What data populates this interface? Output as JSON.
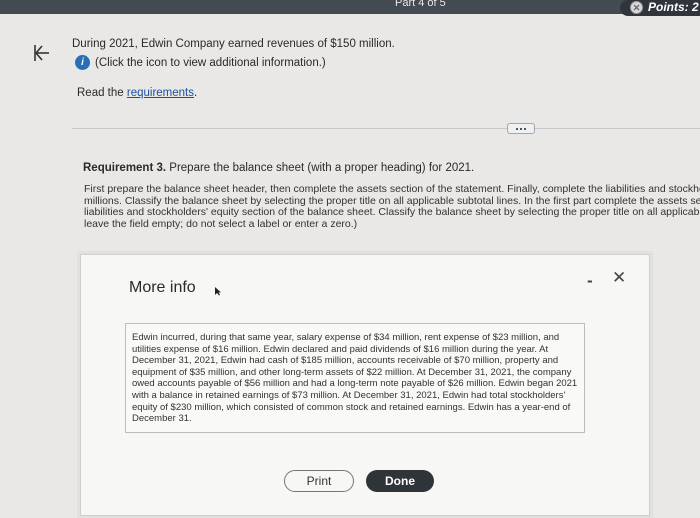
{
  "header": {
    "part_label": "Part 4 of 5",
    "points_label": "Points: 2"
  },
  "question": {
    "statement": "During 2021, Edwin Company earned revenues of $150 million.",
    "info_text": "(Click the icon to view additional information.)",
    "read_prefix": "Read the ",
    "requirements_link": "requirements",
    "read_suffix": "."
  },
  "requirement": {
    "label": "Requirement 3.",
    "text": " Prepare the balance sheet (with a proper heading) for 2021.",
    "instructions": [
      "First prepare the balance sheet header, then complete the assets section of the statement. Finally, complete the liabilities and stockholder",
      "millions. Classify the balance sheet by selecting the proper title on all applicable subtotal lines. In the first part complete the assets section",
      "liabilities and stockholders' equity section of the balance sheet. Classify the balance sheet by selecting the proper title on all applicable sub",
      "leave the field empty; do not select a label or enter a zero.)"
    ]
  },
  "modal": {
    "title": "More info",
    "minimize_glyph": "-",
    "close_glyph": "✕",
    "body_lines": [
      "Edwin incurred, during that same year, salary expense of $34 million, rent expense of $23 million, and",
      "utilities expense of $16 million. Edwin declared and paid dividends of $16 million during the year. At",
      "December 31, 2021, Edwin had cash of $185 million, accounts receivable of $70 million, property and",
      "equipment of $35 million, and other long-term assets of $22 million. At December 31, 2021, the company",
      "owed accounts payable of $56 million and had a long-term note payable of $26 million. Edwin began 2021",
      "with a balance in retained earnings of $73 million. At December 31, 2021, Edwin had total stockholders'",
      "equity of $230 million, which consisted of common stock and retained earnings. Edwin has a year-end of",
      "December 31."
    ],
    "print_label": "Print",
    "done_label": "Done"
  },
  "icons": {
    "back": "back-arrow-icon",
    "info": "info-icon",
    "points": "points-icon",
    "expand": "more-dots-icon",
    "cursor": "mouse-cursor-icon"
  },
  "colors": {
    "topbar": "#434a52",
    "link": "#1e4f9c",
    "info_icon": "#2a6fb5",
    "done_button": "#2f3439"
  }
}
